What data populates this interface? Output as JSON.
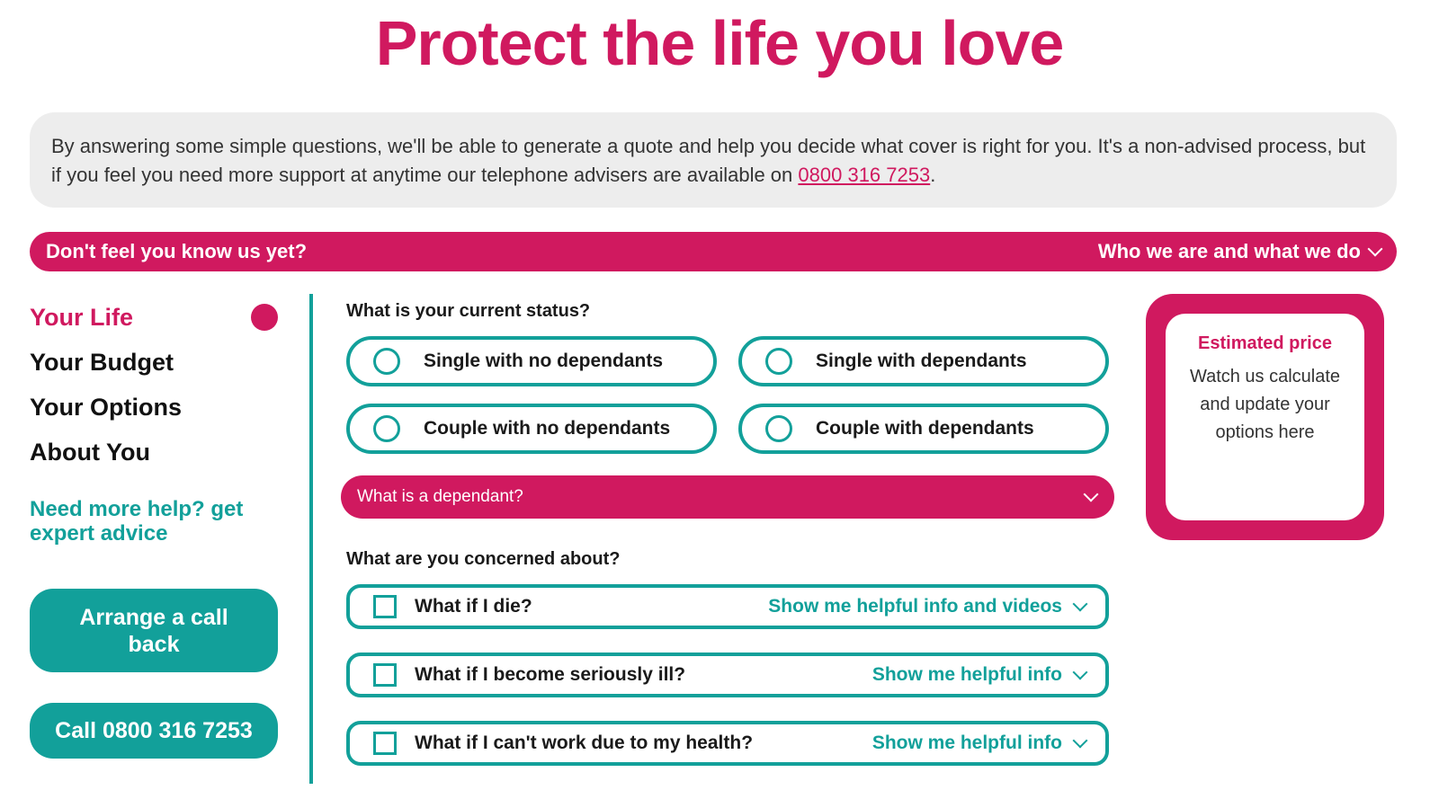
{
  "header": {
    "title": "Protect the life you love"
  },
  "intro": {
    "text": "By answering some simple questions, we'll be able to generate a quote and help you decide what cover is right for you. It's a non-advised process, but if you feel you need more support at anytime our telephone advisers are available on ",
    "phone_link": "0800 316 7253",
    "end": "."
  },
  "knowbar": {
    "left": "Don't feel you know us yet?",
    "right": "Who we are and what we do"
  },
  "steps": [
    {
      "label": "Your Life",
      "active": true
    },
    {
      "label": "Your Budget",
      "active": false
    },
    {
      "label": "Your Options",
      "active": false
    },
    {
      "label": "About You",
      "active": false
    }
  ],
  "help": {
    "text": "Need more help? get expert advice",
    "callback_label": "Arrange a call back",
    "call_label": "Call 0800 316 7253"
  },
  "status": {
    "question": "What is your current status?",
    "options": [
      "Single with no dependants",
      "Single with dependants",
      "Couple with no dependants",
      "Couple with dependants"
    ],
    "dependant_toggle": "What is a dependant?"
  },
  "concerns": {
    "question": "What are you concerned about?",
    "items": [
      {
        "label": "What if I die?",
        "info": "Show me helpful info and videos"
      },
      {
        "label": "What if I become seriously ill?",
        "info": "Show me helpful info"
      },
      {
        "label": "What if I can't work due to my health?",
        "info": "Show me helpful info"
      }
    ]
  },
  "price": {
    "title": "Estimated price",
    "text": "Watch us calculate and update your options here"
  },
  "colors": {
    "brand_pink": "#d0195f",
    "teal": "#12a09a",
    "grey_panel": "#ededed"
  }
}
